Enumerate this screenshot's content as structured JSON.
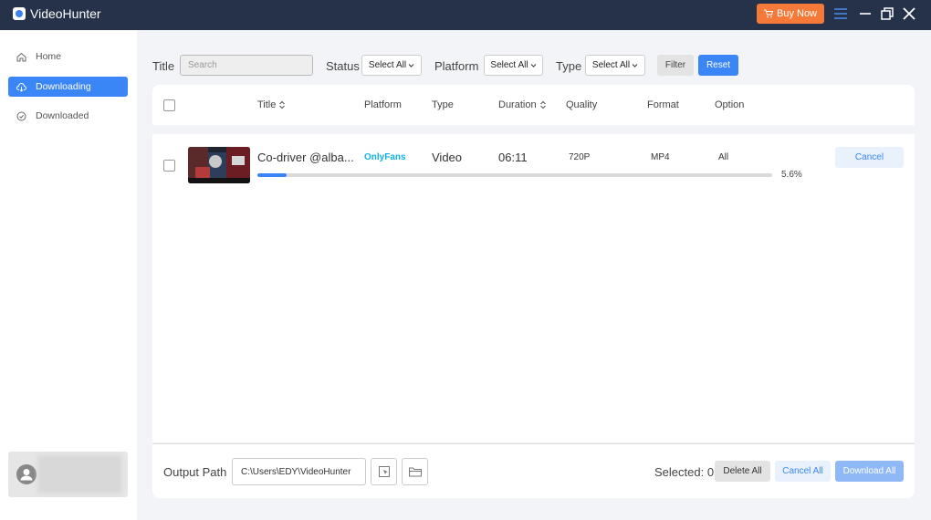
{
  "app": {
    "title": "VideoHunter",
    "buy_label": "Buy Now"
  },
  "sidebar": {
    "items": [
      {
        "label": "Home",
        "icon": "home-icon"
      },
      {
        "label": "Downloading",
        "icon": "download-cloud-icon",
        "active": true
      },
      {
        "label": "Downloaded",
        "icon": "check-circle-icon"
      }
    ]
  },
  "filters": {
    "title_label": "Title",
    "search_placeholder": "Search",
    "status_label": "Status",
    "status_value": "Select All",
    "platform_label": "Platform",
    "platform_value": "Select All",
    "type_label": "Type",
    "type_value": "Select All",
    "filter_label": "Filter",
    "reset_label": "Reset"
  },
  "table": {
    "columns": [
      "Title",
      "Platform",
      "Type",
      "Duration",
      "Quality",
      "Format",
      "Option"
    ],
    "rows": [
      {
        "title": "Co-driver @alba...",
        "platform": "OnlyFans",
        "type": "Video",
        "duration": "06:11",
        "quality": "720P",
        "format": "MP4",
        "option": "All",
        "progress": 5.6,
        "progress_text": "5.6%",
        "cancel_label": "Cancel"
      }
    ]
  },
  "footer": {
    "output_label": "Output Path",
    "output_path": "C:\\Users\\EDY\\VideoHunter",
    "selected_text": "Selected: 0",
    "delete_all_label": "Delete All",
    "cancel_all_label": "Cancel All",
    "download_all_label": "Download All"
  },
  "colors": {
    "accent": "#3b86f7",
    "titlebar": "#253249",
    "buy": "#f57a3a",
    "onlyfans": "#11b3e6"
  }
}
